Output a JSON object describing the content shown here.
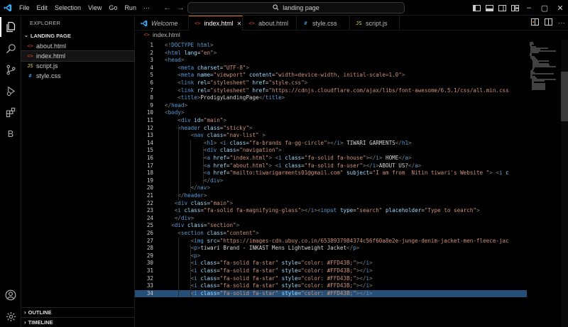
{
  "colors": {
    "tag": "#569cd6",
    "attr": "#9cdcfe",
    "string": "#ce9178",
    "text": "#d4d4d4",
    "punct": "#808080",
    "accent": "#e07a1f",
    "html_icon": "#e44d26",
    "js_icon": "#f0db4f",
    "css_icon": "#42a5f5"
  },
  "titlebar": {
    "menu": [
      "File",
      "Edit",
      "Selection",
      "View",
      "Go",
      "Run"
    ],
    "more_icon": "ellipsis-icon",
    "search_text": "landing page"
  },
  "activitybar": [
    "explorer-icon",
    "search-icon",
    "source-control-icon",
    "run-debug-icon",
    "extensions-icon",
    "b-icon",
    "account-icon",
    "settings-icon"
  ],
  "activitybar_b_label": "B",
  "sidebar": {
    "title": "EXPLORER",
    "root": "LANDING PAGE",
    "files": [
      {
        "name": "about.html",
        "type": "html"
      },
      {
        "name": "index.html",
        "type": "html"
      },
      {
        "name": "script.js",
        "type": "js"
      },
      {
        "name": "style.css",
        "type": "css"
      }
    ],
    "outline": "OUTLINE",
    "timeline": "TIMELINE"
  },
  "tabs": [
    {
      "label": "Welcome",
      "type": "vscode"
    },
    {
      "label": "index.html",
      "type": "html"
    },
    {
      "label": "about.html",
      "type": "html"
    },
    {
      "label": "style.css",
      "type": "css"
    },
    {
      "label": "script.js",
      "type": "js"
    }
  ],
  "breadcrumb": "index.html",
  "code_lines": [
    {
      "n": "1",
      "t": "<!DOCTYPE html>"
    },
    {
      "n": "2",
      "t": "<html lang=\"en\">"
    },
    {
      "n": "3",
      "t": "<head>"
    },
    {
      "n": "4",
      "t": "    <meta charset=\"UTF-8\">"
    },
    {
      "n": "5",
      "t": "    <meta name=\"viewport\" content=\"width=device-width, initial-scale=1.0\">"
    },
    {
      "n": "6",
      "t": "    <link rel=\"stylesheet\" href=\"style.css\">"
    },
    {
      "n": "7",
      "t": "    <link rel=\"stylesheet\" href=\"https://cdnjs.cloudflare.com/ajax/libs/font-awesome/6.5.1/css/all.min.css"
    },
    {
      "n": "8",
      "t": "    <title>ProdigyLandingPage</title>"
    },
    {
      "n": "9",
      "t": "</head>"
    },
    {
      "n": "10",
      "t": "<body>"
    },
    {
      "n": "11",
      "t": "    <div id=\"main\">"
    },
    {
      "n": "12",
      "t": "    <header class=\"sticky\">"
    },
    {
      "n": "13",
      "t": "        <nav class=\"nav-list\" >"
    },
    {
      "n": "14",
      "t": "            <h1> <i class=\"fa-brands fa-gg-circle\"></i> TIWARI GARMENTS</h1>"
    },
    {
      "n": "15",
      "t": "            <div class=\"navigation\">"
    },
    {
      "n": "16",
      "t": "            <a href=\"index.html\"> <i class=\"fa-solid fa-house\"></i> HOME</a>"
    },
    {
      "n": "17",
      "t": "            <a href=\"about.html\"> <i class=\"fa-solid fa-user\"></i>ABOUT US?</a>"
    },
    {
      "n": "18",
      "t": "            <a href=\"mailto:tiwarigarments01@gmail.com\" subject=\"I am from  Nitin tiwari's Website \"> <i c"
    },
    {
      "n": "19",
      "t": "            </div>"
    },
    {
      "n": "20",
      "t": "        </nav>"
    },
    {
      "n": "21",
      "t": "    </header>"
    },
    {
      "n": "22",
      "t": "   <div class=\"main\">"
    },
    {
      "n": "23",
      "t": "   <i class=\"fa-solid fa-magnifying-glass\"></i><input type=\"search\" placeholder=\"Type to search\">"
    },
    {
      "n": "24",
      "t": "   </div>"
    },
    {
      "n": "25",
      "t": "  <div class=\"section\">"
    },
    {
      "n": "26",
      "t": "    <section class=\"content\">"
    },
    {
      "n": "27",
      "t": "        <img src=\"https://images-cdn.ubuy.co.in/6538937984374c56f60a8e2e-junge-denim-jacket-men-fleece-jac"
    },
    {
      "n": "28",
      "t": "        <p>tiwari Brand - INKAST Mens Lightweight Jacket</p>"
    },
    {
      "n": "29",
      "t": "        <p>"
    },
    {
      "n": "30",
      "t": "        <i class=\"fa-solid fa-star\" style=\"color: #FFD43B;\"></i>"
    },
    {
      "n": "31",
      "t": "        <i class=\"fa-solid fa-star\" style=\"color: #FFD43B;\"></i>"
    },
    {
      "n": "32",
      "t": "        <i class=\"fa-solid fa-star\" style=\"color: #FFD43B;\"></i>"
    },
    {
      "n": "33",
      "t": "        <i class=\"fa-solid fa-star\" style=\"color: #FFD43B;\"></i>"
    },
    {
      "n": "34",
      "t": "        <i class=\"fa-solid fa-star\" style=\"color: #FFD43B;\"></i>"
    }
  ]
}
